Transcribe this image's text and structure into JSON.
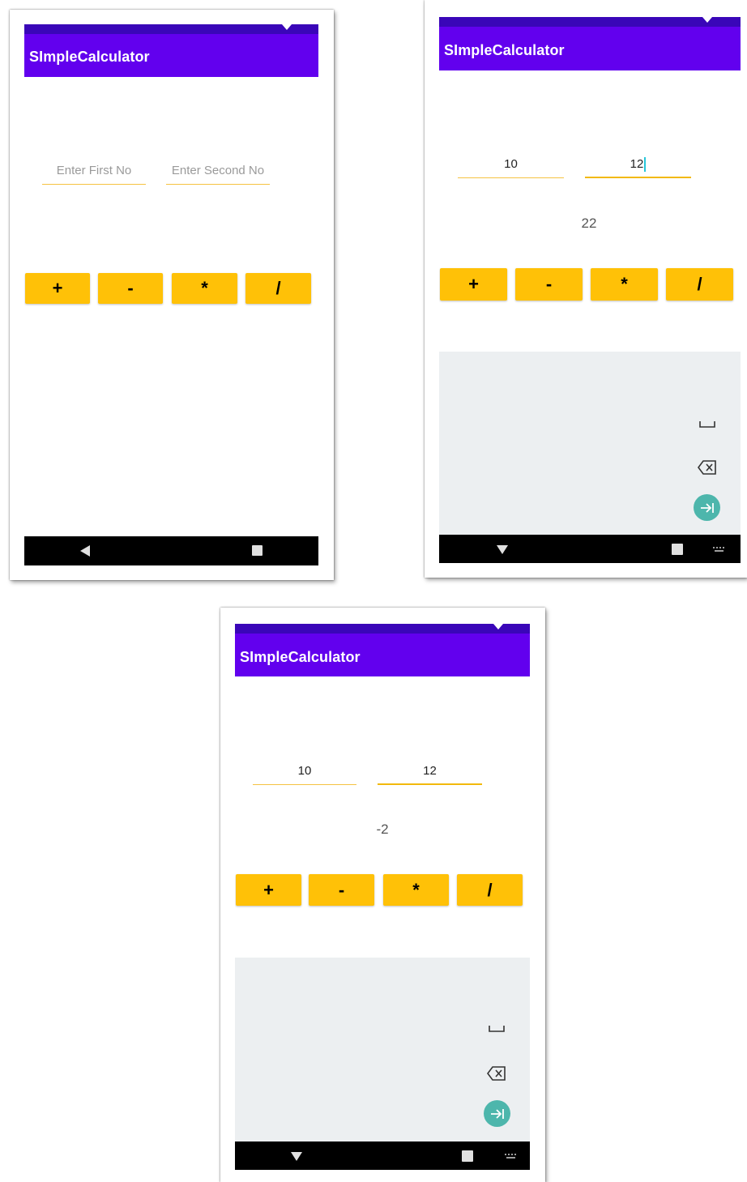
{
  "app": {
    "title": "SImpleCalculator"
  },
  "screens": [
    {
      "first_input": {
        "value": "",
        "placeholder": "Enter First No"
      },
      "second_input": {
        "value": "",
        "placeholder": "Enter Second No"
      },
      "result": "",
      "buttons": [
        "+",
        "-",
        "*",
        "/"
      ],
      "keyboard_visible": false
    },
    {
      "first_input": {
        "value": "10",
        "placeholder": "Enter First No"
      },
      "second_input": {
        "value": "12",
        "placeholder": "Enter Second No"
      },
      "result": "22",
      "buttons": [
        "+",
        "-",
        "*",
        "/"
      ],
      "keyboard_visible": true
    },
    {
      "first_input": {
        "value": "10",
        "placeholder": "Enter First No"
      },
      "second_input": {
        "value": "12",
        "placeholder": "Enter Second No"
      },
      "result": "-2",
      "buttons": [
        "+",
        "-",
        "*",
        "/"
      ],
      "keyboard_visible": true
    }
  ],
  "icons": {
    "back": "back-triangle-icon",
    "home": "home-square-icon",
    "hide_keyboard": "hide-keyboard-icon",
    "space": "space-key-icon",
    "backspace": "backspace-icon",
    "next": "next-arrow-icon",
    "keyboard_switch": "keyboard-switch-icon"
  },
  "colors": {
    "status_bar": "#3a06b8",
    "app_bar": "#6200ee",
    "button": "#ffc107",
    "underline": "#f5c242",
    "keyboard_bg": "#eceff1",
    "fab": "#4db6ac"
  }
}
